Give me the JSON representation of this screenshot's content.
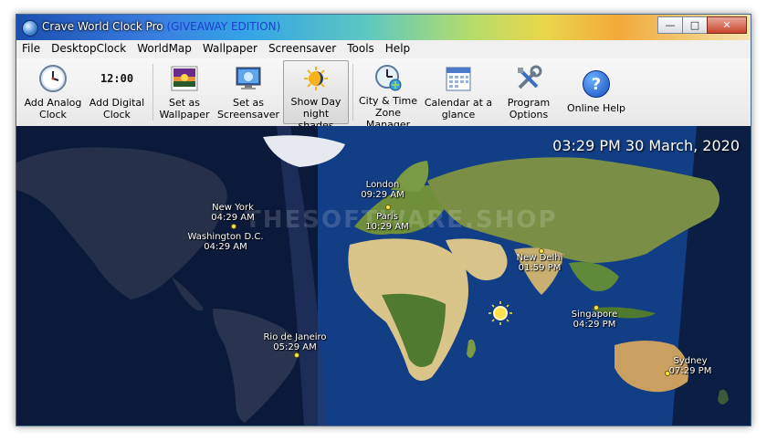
{
  "window": {
    "title": "Crave World Clock Pro",
    "edition": "(GIVEAWAY EDITION)",
    "buttons": {
      "minimize": "—",
      "maximize": "□",
      "close": "✕"
    }
  },
  "menu": [
    "File",
    "DesktopClock",
    "WorldMap",
    "Wallpaper",
    "Screensaver",
    "Tools",
    "Help"
  ],
  "toolbar": [
    {
      "line1": "Add Analog",
      "line2": "Clock",
      "icon": "analog-clock-icon"
    },
    {
      "line1": "Add Digital",
      "line2": "Clock",
      "icon": "digital-clock-icon",
      "icon_text": "12:00"
    },
    {
      "line1": "Set as",
      "line2": "Wallpaper",
      "icon": "wallpaper-icon"
    },
    {
      "line1": "Set as",
      "line2": "Screensaver",
      "icon": "screensaver-icon"
    },
    {
      "line1": "Show Day",
      "line2": "night shades",
      "icon": "day-night-icon"
    },
    {
      "line1": "City & Time",
      "line2": "Zone Manager",
      "icon": "timezone-manager-icon"
    },
    {
      "line1": "Calendar at a",
      "line2": "glance",
      "icon": "calendar-icon"
    },
    {
      "line1": "Program",
      "line2": "Options",
      "icon": "tools-icon"
    },
    {
      "line1": "Online Help",
      "line2": "",
      "icon": "help-icon",
      "icon_text": "?"
    }
  ],
  "map": {
    "datetime": "03:29 PM 30 March, 2020",
    "watermark": "THESOFTWARE.SHOP",
    "cities": [
      {
        "name": "New York",
        "time": "04:29 AM"
      },
      {
        "name": "Washington D.C.",
        "time": "04:29 AM"
      },
      {
        "name": "London",
        "time": "09:29 AM"
      },
      {
        "name": "Paris",
        "time": "10:29 AM"
      },
      {
        "name": "New Delhi",
        "time": "01:59 PM"
      },
      {
        "name": "Singapore",
        "time": "04:29 PM"
      },
      {
        "name": "Rio de Janeiro",
        "time": "05:29 AM"
      },
      {
        "name": "Sydney",
        "time": "07:29 PM"
      }
    ]
  }
}
